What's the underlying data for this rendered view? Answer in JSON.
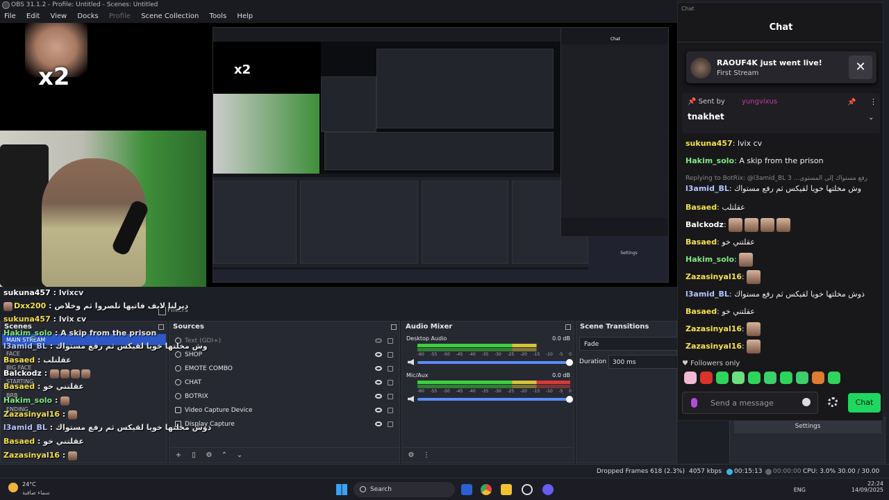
{
  "window": {
    "title": "OBS 31.1.2 - Profile: Untitled - Scenes: Untitled"
  },
  "menu": {
    "items": [
      "File",
      "Edit",
      "View",
      "Docks",
      "Profile",
      "Scene Collection",
      "Tools",
      "Help"
    ]
  },
  "preview": {
    "emote_multiplier": "x2"
  },
  "overlay_chat": {
    "lines": [
      {
        "user": "sukuna457",
        "sep": " : ",
        "text": "lvixcv"
      },
      {
        "user": "Dxx200",
        "sep": " : ",
        "text": "ديرلنا لايف فاتيها تلصروا ثم وخلاص"
      },
      {
        "user": "sukuna457",
        "sep": " : ",
        "text": "lvix cv"
      },
      {
        "user": "Hakim_solo",
        "sep": " : ",
        "text": "A skip from the prison"
      },
      {
        "user": "l3amid_BL",
        "sep": " : ",
        "text": "وش مخلتها خويا لقيكس ثم رفع مستواك"
      },
      {
        "user": "Basaed",
        "sep": " : ",
        "text": "عقلتلب"
      },
      {
        "user": "Balckodz",
        "sep": " : ",
        "text": ""
      },
      {
        "user": "Basaed",
        "sep": " : ",
        "text": "عقلتني خو"
      },
      {
        "user": "Hakim_solo",
        "sep": " : ",
        "text": ""
      },
      {
        "user": "Zazasinyal16",
        "sep": " : ",
        "text": ""
      },
      {
        "user": "l3amid_BL",
        "sep": " : ",
        "text": "ذوش مخلتها خويا لقيكس ثم رفع مستواك"
      },
      {
        "user": "Basaed",
        "sep": " : ",
        "text": "عقلتني خو"
      },
      {
        "user": "Zazasinyal16",
        "sep": " : ",
        "text": ""
      }
    ]
  },
  "docks": {
    "filters_label": "Filters",
    "scenes": {
      "title": "Scenes",
      "items": [
        "MAIN STREAM",
        "FACE",
        "BIG FACE",
        "STARTING",
        "BRB",
        "ENDING"
      ]
    },
    "sources": {
      "title": "Sources",
      "items": [
        {
          "name": "Text (GDI+)",
          "hidden": true
        },
        {
          "name": "SHOP"
        },
        {
          "name": "EMOTE COMBO"
        },
        {
          "name": "CHAT"
        },
        {
          "name": "BOTRIX"
        },
        {
          "name": "Video Capture Device"
        },
        {
          "name": "Display Capture"
        }
      ]
    },
    "mixer": {
      "title": "Audio Mixer",
      "channels": [
        {
          "name": "Desktop Audio",
          "db": "0.0 dB",
          "level": 0.78
        },
        {
          "name": "Mic/Aux",
          "db": "0.0 dB",
          "level": 1.0
        }
      ],
      "scale": [
        "-60",
        "-55",
        "-50",
        "-45",
        "-40",
        "-35",
        "-30",
        "-25",
        "-20",
        "-15",
        "-10",
        "-5",
        "0"
      ]
    },
    "transitions": {
      "title": "Scene Transitions",
      "type": "Fade",
      "duration_label": "Duration",
      "duration": "300 ms"
    },
    "controls": {
      "settings_label": "Settings"
    }
  },
  "status": {
    "dropped": "Dropped Frames 618 (2.3%)",
    "bitrate": "4057 kbps",
    "live_time": "00:15:13",
    "rec_time": "00:00:00",
    "cpu": "CPU: 3.0%",
    "fps": "30.00 / 30.00 FPS"
  },
  "chat": {
    "window_label": "Chat",
    "header": "Chat",
    "live_card": {
      "title": "RAOUF4K just went live!",
      "subtitle": "First Stream",
      "close": "✕"
    },
    "pinned": {
      "sent_by": "Sent by",
      "user": "yungvixus",
      "message": "tnakhet"
    },
    "messages": [
      {
        "user": "sukuna457",
        "color": "#f4e04d",
        "text": "lvix cv"
      },
      {
        "user": "Hakim_solo",
        "color": "#7fe87f",
        "text": "A skip from the prison"
      },
      {
        "reply": "Replying to BotRix: @l3amid_BL 3 ...رفع مستواك إلى المستوى"
      },
      {
        "user": "l3amid_BL",
        "color": "#b4c6ff",
        "text": "وش مخلتها خويا لقيكس ثم رفع مستواك"
      },
      {
        "user": "Basaed",
        "color": "#f4e04d",
        "text": "عقلتلب"
      },
      {
        "user": "Balckodz",
        "color": "#ffffff",
        "text": ""
      },
      {
        "user": "Basaed",
        "color": "#f4e04d",
        "text": "عقلتني خو"
      },
      {
        "user": "Hakim_solo",
        "color": "#7fe87f",
        "text": ""
      },
      {
        "user": "Zazasinyal16",
        "color": "#f4e04d",
        "text": ""
      },
      {
        "user": "l3amid_BL",
        "color": "#b4c6ff",
        "text": "ذوش مخلتها خويا لقيكس ثم رفع مستواك"
      },
      {
        "user": "Basaed",
        "color": "#f4e04d",
        "text": "عقلتني خو"
      },
      {
        "user": "Zazasinyal16",
        "color": "#f4e04d",
        "text": ""
      },
      {
        "user": "Zazasinyal16",
        "color": "#f4e04d",
        "text": ""
      }
    ],
    "followers_only": "Followers only",
    "input_placeholder": "Send a message",
    "send_label": "Chat",
    "colors": {
      "accent": "#1dd75f",
      "pinned_user": "#c43aa5"
    }
  },
  "taskbar": {
    "weather_temp": "24°C",
    "weather_desc": "سماء صافية",
    "search": "Search",
    "lang": "ENG",
    "time": "22:24",
    "date": "14/09/2025"
  }
}
